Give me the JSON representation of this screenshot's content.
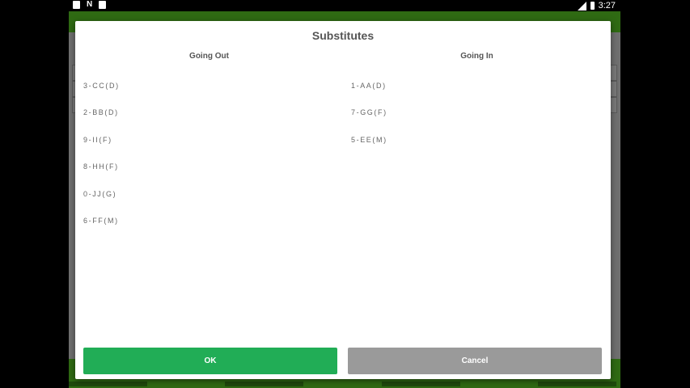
{
  "status_bar": {
    "time": "3:27"
  },
  "dialog": {
    "title": "Substitutes",
    "going_out": {
      "header": "Going Out",
      "players": [
        "3-CC(D)",
        "2-BB(D)",
        "9-II(F)",
        "8-HH(F)",
        "0-JJ(G)",
        "6-FF(M)"
      ]
    },
    "going_in": {
      "header": "Going In",
      "players": [
        "1-AA(D)",
        "7-GG(F)",
        "5-EE(M)"
      ]
    },
    "ok_label": "OK",
    "cancel_label": "Cancel"
  },
  "colors": {
    "app_green": "#2f6a13",
    "ok_button": "#21ad56",
    "cancel_button": "#9a9a9a",
    "dim_background": "#6f6f6f"
  }
}
